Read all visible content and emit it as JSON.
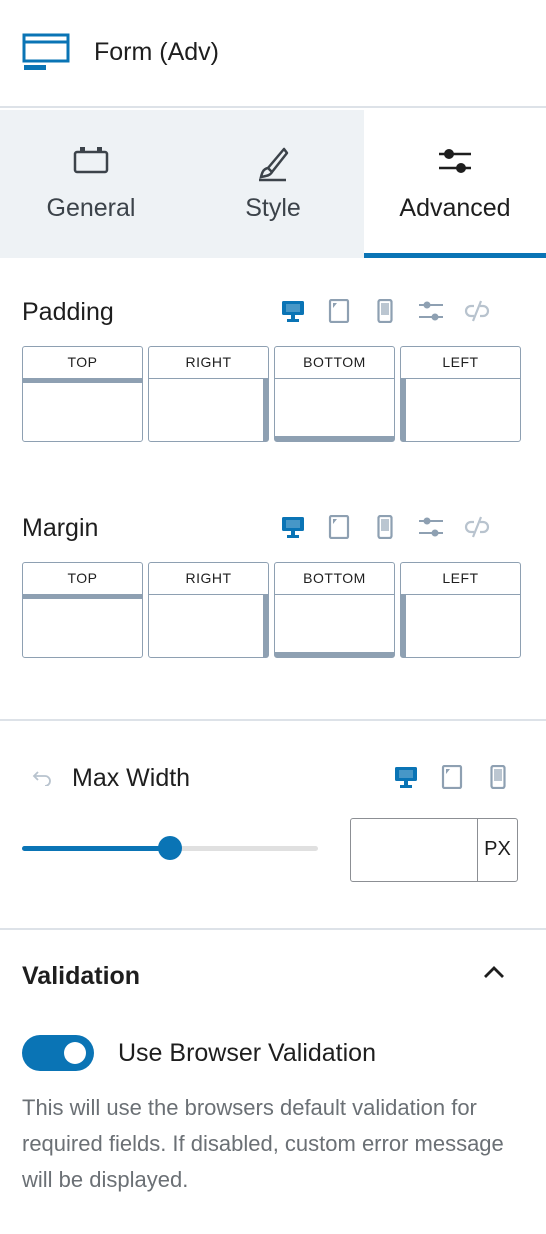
{
  "header": {
    "title": "Form (Adv)",
    "icon": "form-block-icon"
  },
  "tabs": [
    {
      "label": "General",
      "icon": "general-icon",
      "active": false
    },
    {
      "label": "Style",
      "icon": "brush-icon",
      "active": false
    },
    {
      "label": "Advanced",
      "icon": "sliders-icon",
      "active": true
    }
  ],
  "padding": {
    "label": "Padding",
    "sides": [
      "TOP",
      "RIGHT",
      "BOTTOM",
      "LEFT"
    ]
  },
  "margin": {
    "label": "Margin",
    "sides": [
      "TOP",
      "RIGHT",
      "BOTTOM",
      "LEFT"
    ]
  },
  "max_width": {
    "label": "Max Width",
    "value": "",
    "unit": "PX",
    "slider_fraction": 0.5
  },
  "validation": {
    "title": "Validation",
    "toggle_label": "Use Browser Validation",
    "toggle_on": true,
    "help": "This will use the browsers default validation for required fields. If disabled, custom error message will be displayed."
  },
  "colors": {
    "accent": "#0a74b5",
    "box_border": "#8ea0b2",
    "divider": "#dde2e8",
    "tab_bg": "#eef2f5",
    "help_text": "#6b7075"
  }
}
